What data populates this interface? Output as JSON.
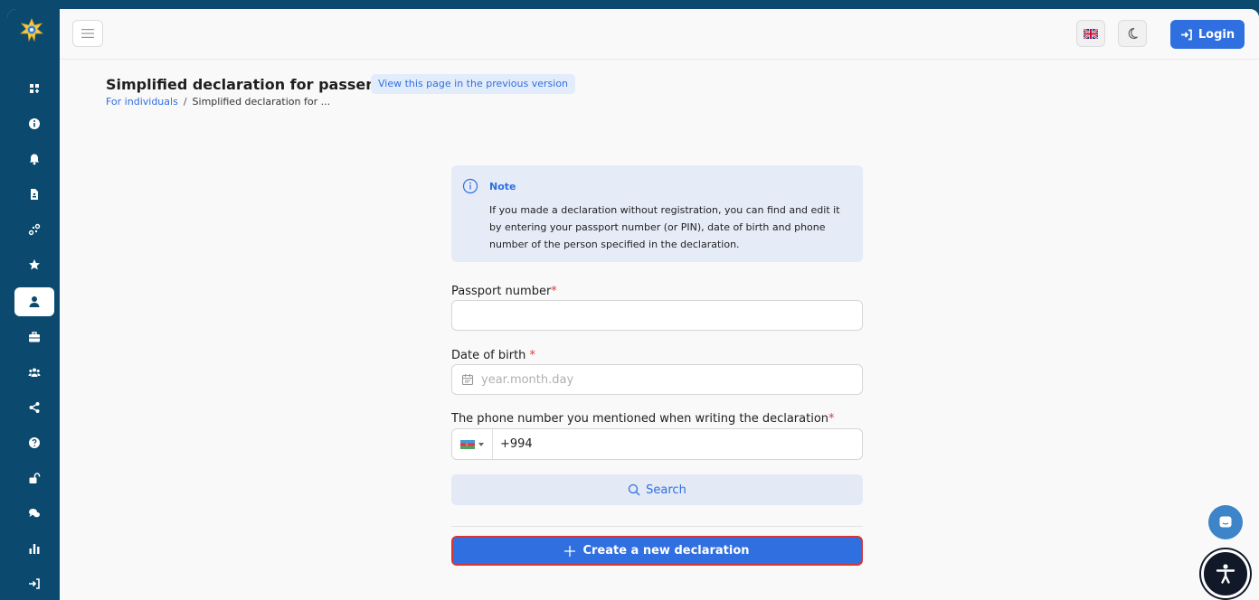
{
  "header": {
    "login_label": "Login",
    "language": "uk-flag-icon",
    "theme": "moon-icon"
  },
  "sidebar": {
    "items": [
      {
        "icon": "dashboard-icon"
      },
      {
        "icon": "info-icon"
      },
      {
        "icon": "bell-icon"
      },
      {
        "icon": "document-icon"
      },
      {
        "icon": "connections-icon"
      },
      {
        "icon": "star-icon"
      },
      {
        "icon": "user-icon",
        "active": true
      },
      {
        "icon": "briefcase-icon"
      },
      {
        "icon": "users-icon"
      },
      {
        "icon": "share-icon"
      },
      {
        "icon": "help-icon"
      },
      {
        "icon": "unlock-icon"
      },
      {
        "icon": "chat-icon"
      },
      {
        "icon": "chart-icon"
      },
      {
        "icon": "logout-icon"
      }
    ]
  },
  "page": {
    "title": "Simplified declaration for passengers",
    "prev_version_label": "View this page in the previous version",
    "breadcrumb": {
      "link": "For individuals",
      "separator": "/",
      "current": "Simplified declaration for ..."
    }
  },
  "note": {
    "title": "Note",
    "text": "If you made a declaration without registration, you can find and edit it by entering your passport number (or PIN), date of birth and phone number of the person specified in the declaration."
  },
  "form": {
    "passport_label": "Passport number",
    "passport_value": "",
    "dob_label": "Date of birth ",
    "dob_placeholder": "year.month.day",
    "phone_label": "The phone number you mentioned when writing the declaration",
    "phone_value": "+994",
    "required_mark": "*",
    "search_label": "Search",
    "create_label": "Create a new declaration"
  },
  "colors": {
    "sidebar": "#0b4a6e",
    "accent": "#2f6fe0",
    "required": "#e53935"
  }
}
